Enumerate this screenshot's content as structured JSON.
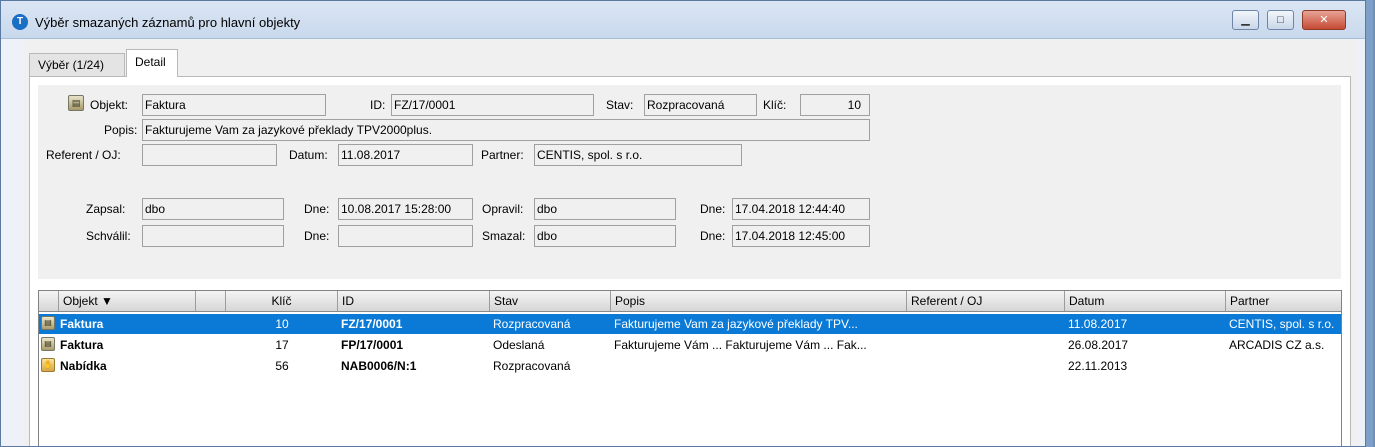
{
  "window": {
    "title": "Výběr smazaných záznamů pro hlavní objekty",
    "icon": "app-logo-icon",
    "minimize": "minimize-icon",
    "maximize": "maximize-icon",
    "close": "close-icon"
  },
  "tabs": [
    {
      "label": "Výběr (1/24)",
      "active": false
    },
    {
      "label": "Detail",
      "active": true
    }
  ],
  "detail": {
    "objekt_label": "Objekt:",
    "objekt_value": "Faktura",
    "id_label": "ID:",
    "id_value": "FZ/17/0001",
    "stav_label": "Stav:",
    "stav_value": "Rozpracovaná",
    "klic_label": "Klíč:",
    "klic_value": "10",
    "popis_label": "Popis:",
    "popis_value": "Fakturujeme Vam za jazykové překlady TPV2000plus.",
    "referent_label": "Referent / OJ:",
    "referent_value": "",
    "datum_label": "Datum:",
    "datum_value": "11.08.2017",
    "partner_label": "Partner:",
    "partner_value": "CENTIS, spol. s r.o.",
    "zapsal_label": "Zapsal:",
    "zapsal_value": "dbo",
    "zapsal_dne_label": "Dne:",
    "zapsal_dne_value": "10.08.2017 15:28:00",
    "opravil_label": "Opravil:",
    "opravil_value": "dbo",
    "opravil_dne_label": "Dne:",
    "opravil_dne_value": "17.04.2018 12:44:40",
    "schvalil_label": "Schválil:",
    "schvalil_value": "",
    "schvalil_dne_label": "Dne:",
    "schvalil_dne_value": "",
    "smazal_label": "Smazal:",
    "smazal_value": "dbo",
    "smazal_dne_label": "Dne:",
    "smazal_dne_value": "17.04.2018 12:45:00"
  },
  "grid": {
    "columns": [
      "",
      "Objekt ▼",
      "",
      "Klíč",
      "ID",
      "Stav",
      "Popis",
      "Referent / OJ",
      "Datum",
      "Partner"
    ],
    "rows": [
      {
        "icon": "document-icon",
        "objekt": "Faktura",
        "klic": "10",
        "id": "FZ/17/0001",
        "stav": "Rozpracovaná",
        "popis": "Fakturujeme Vam za jazykové překlady TPV...",
        "referent": "",
        "datum": "11.08.2017",
        "partner": "CENTIS, spol. s r.o.",
        "selected": true
      },
      {
        "icon": "document-icon",
        "objekt": "Faktura",
        "klic": "17",
        "id": "FP/17/0001",
        "stav": "Odeslaná",
        "popis": "Fakturujeme Vám ... Fakturujeme Vám ... Fak...",
        "referent": "",
        "datum": "26.08.2017",
        "partner": "ARCADIS CZ a.s.",
        "selected": false
      },
      {
        "icon": "offer-hand-icon",
        "objekt": "Nabídka",
        "klic": "56",
        "id": "NAB0006/N:1",
        "stav": "Rozpracovaná",
        "popis": "",
        "referent": "",
        "datum": "22.11.2013",
        "partner": "",
        "selected": false
      }
    ]
  },
  "colors": {
    "selection": "#0a7ad6",
    "titlebar": "#c8d8ec",
    "close_button": "#c54b34"
  }
}
